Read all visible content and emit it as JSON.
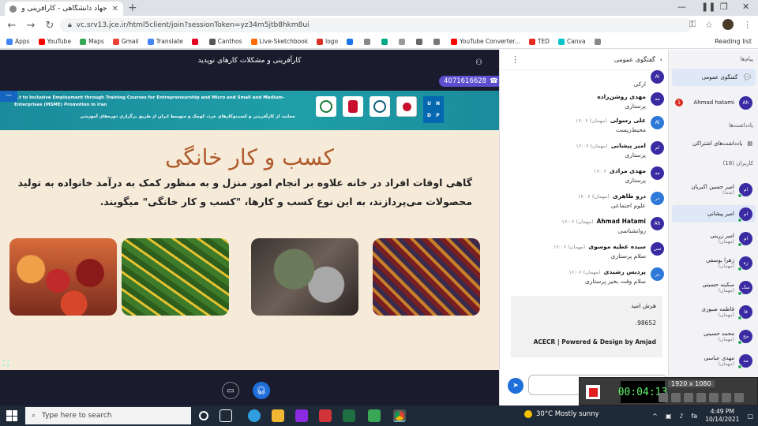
{
  "browser": {
    "tab_title": "جهاد دانشگاهی - کارآفرینی و م...",
    "url": "vc.srv13.jce.ir/html5client/join?sessionToken=yz34m5jtb8hkm8ui",
    "bookmarks": [
      "Apps",
      "YouTube",
      "Maps",
      "Gmail",
      "Translate",
      "",
      "Canthos",
      "Live-Sketchbook",
      "logo",
      "",
      "",
      "",
      "",
      "",
      "",
      "YouTube Converter...",
      "TED",
      "Canva",
      ""
    ],
    "reading_list": "Reading list",
    "icons": {
      "back": "arrow-left-icon",
      "forward": "arrow-right-icon",
      "reload": "reload-icon",
      "lock": "lock-icon",
      "key": "key-icon",
      "star": "star-icon",
      "menu": "kebab-menu-icon"
    }
  },
  "presentation": {
    "title": "کارآفرینی و مشکلات کارهای نوپدید",
    "session_number": "4071616628",
    "slide": {
      "banner_en": "...t to Inclusive Employment through Training Courses for Entrepreneurship and Micro and Small and Medium-Enterprises (MSME) Promotion in Iran",
      "banner_fa": "حمایت از کارآفرینی و کسب‌وکارهای خرد، کوچک و متوسط ایران از طریق برگزاری دوره‌های آموزشی",
      "heading": "کسب و کار خانگی",
      "body": "گاهی اوقات افراد در خانه علاوه بر انجام امور منزل و به منظور کمک به درآمد خانواده به تولید محصولات می‌پردازند، به این نوع کسب و کارها، \"کسب و کار خانگی\" میگویند.",
      "photos": [
        "jars-of-preserves",
        "vegetable-crates",
        "sewing-workshop",
        "carpet-weaving"
      ]
    }
  },
  "chat": {
    "header": "گفتگوی عمومی",
    "messages": [
      {
        "name": "",
        "time": "",
        "text": "ارکی",
        "avatar": "Ai"
      },
      {
        "name": "مهدی روشن‌زاده",
        "time": "",
        "text": "پرستاری",
        "avatar": "مه"
      },
      {
        "name": "علی رسولی",
        "time": "(مهمان) ۱۶:۰۶",
        "text": "محیط‌زیست",
        "avatar": "Al"
      },
      {
        "name": "امیر پیشانی",
        "time": "(مهمان) ۱۶:۰۶",
        "text": "پرستاری",
        "avatar": "ام"
      },
      {
        "name": "مهدی مرادی",
        "time": "۱۶:۰۶",
        "text": "پرستاری",
        "avatar": "مه"
      },
      {
        "name": "درو ظاهری",
        "time": "(مهمان) ۱۶:۰۶",
        "text": "علوم اجتماعی",
        "avatar": "در"
      },
      {
        "name": "Ahmad Hatami",
        "time": "(مهمان) ۱۶:۰۶",
        "text": "روانشناسی",
        "avatar": "Ah"
      },
      {
        "name": "سیده عطیه موسوی",
        "time": "(مهمان) ۱۶:۰۶",
        "text": "سلام پرستاری",
        "avatar": "سی"
      },
      {
        "name": "پردیس رشیدی",
        "time": "(مهمان) ۱۶:۰۶",
        "text": "سلام وقت بخیر پرستاری",
        "avatar": "پر"
      }
    ],
    "notice": {
      "line1": "هرش امید",
      "line2": "98652.",
      "brand": "ACECR | Powered & Design by Amjad"
    },
    "input_placeholder": ""
  },
  "users": {
    "messages_heading": "پیام‌ها",
    "public_chat": "گفتگوی عمومی",
    "private_chat": {
      "name": "Ahmad hatami",
      "avatar": "Ah",
      "unread": "1"
    },
    "notes_heading": "یادداشت‌ها",
    "shared_notes": "یادداشت‌های اشتراکی",
    "users_heading": "کاربران (16)",
    "list": [
      {
        "name": "امیر حسین اکبریان",
        "sub": "(شما)",
        "avatar": "ام"
      },
      {
        "name": "امیر پیشانی",
        "sub": "",
        "avatar": "ام"
      },
      {
        "name": "امیر زرینی",
        "sub": "(مهمان)",
        "avatar": "ام"
      },
      {
        "name": "زهرا یوسفی",
        "sub": "(مهمان)",
        "avatar": "زه"
      },
      {
        "name": "سکینه حسینی",
        "sub": "(مهمان)",
        "avatar": "سک"
      },
      {
        "name": "فاطمه صبوری",
        "sub": "(مهمان)",
        "avatar": "فا"
      },
      {
        "name": "محمد حسینی",
        "sub": "(مهمان)",
        "avatar": "مح"
      },
      {
        "name": "مهدی عباسی",
        "sub": "(مهمان)",
        "avatar": "مه"
      }
    ]
  },
  "recorder": {
    "time": "00:04:13",
    "resolution": "1920 x 1080"
  },
  "taskbar": {
    "search_placeholder": "Type here to search",
    "weather": "30°C  Mostly sunny",
    "time": "4:49 PM",
    "date": "10/14/2021"
  }
}
